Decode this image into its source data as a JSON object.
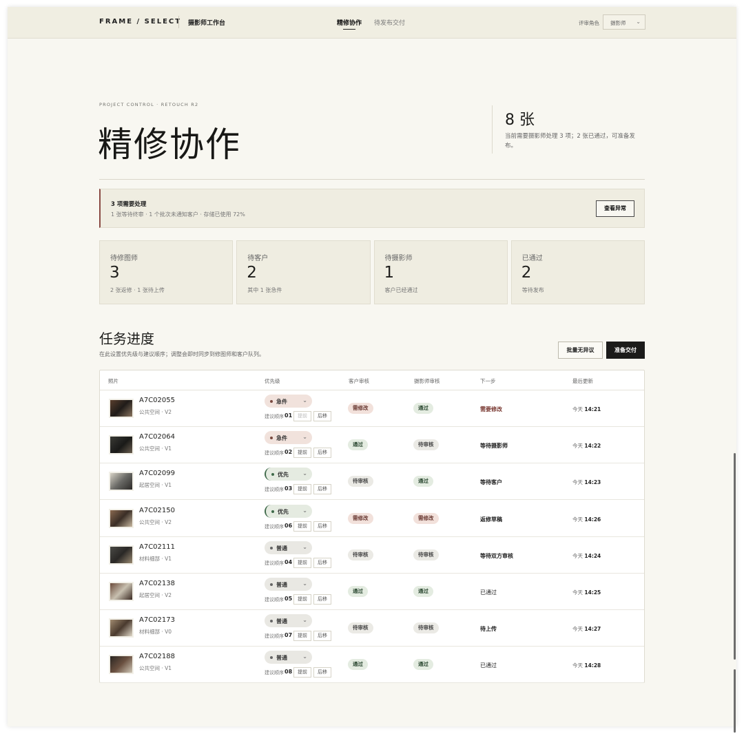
{
  "header": {
    "brand": "FRAME / SELECT",
    "subtitle": "摄影师工作台",
    "nav": [
      "精修协作",
      "待发布交付"
    ],
    "role_label": "评审角色",
    "role_value": "摄影师"
  },
  "hero": {
    "eyebrow": "PROJECT CONTROL · RETOUCH R2",
    "title": "精修协作",
    "count": "8 张",
    "count_note": "当前需要摄影师处理 3 项；2 张已通过，可准备发布。"
  },
  "alert": {
    "title": "3 项需要处理",
    "desc": "1 张等待终审 · 1 个批次未通知客户 · 存储已使用 72%",
    "button": "查看异常",
    "accent": "#8a4a43"
  },
  "cards": [
    {
      "label": "待修图师",
      "num": "3",
      "note": "2 张返修 · 1 张待上传"
    },
    {
      "label": "待客户",
      "num": "2",
      "note": "其中 1 张急件"
    },
    {
      "label": "待摄影师",
      "num": "1",
      "note": "客户已经通过"
    },
    {
      "label": "已通过",
      "num": "2",
      "note": "等待发布"
    }
  ],
  "section": {
    "title": "任务进度",
    "desc": "在此设置优先级与建议顺序；调整会即时同步到修图师和客户队列。",
    "btn_secondary": "批量无异议",
    "btn_primary": "准备交付"
  },
  "table": {
    "headers": [
      "照片",
      "优先级",
      "客户审核",
      "摄影师审核",
      "下一步",
      "最后更新"
    ],
    "order_label": "建议顺序",
    "up_label": "提前",
    "down_label": "后移",
    "rows": [
      {
        "id": "A7C02055",
        "meta": "公共空间 · V2",
        "priority": "急件",
        "order": "01",
        "client": "需修改",
        "photographer": "通过",
        "next": "需要修改",
        "day": "今天",
        "time": "14:21"
      },
      {
        "id": "A7C02064",
        "meta": "公共空间 · V1",
        "priority": "急件",
        "order": "02",
        "client": "通过",
        "photographer": "待审核",
        "next": "等待摄影师",
        "day": "今天",
        "time": "14:22"
      },
      {
        "id": "A7C02099",
        "meta": "起居空间 · V1",
        "priority": "优先",
        "order": "03",
        "client": "待审核",
        "photographer": "通过",
        "next": "等待客户",
        "day": "今天",
        "time": "14:23"
      },
      {
        "id": "A7C02150",
        "meta": "公共空间 · V2",
        "priority": "优先",
        "order": "06",
        "client": "需修改",
        "photographer": "需修改",
        "next": "返修草稿",
        "day": "今天",
        "time": "14:26"
      },
      {
        "id": "A7C02111",
        "meta": "材料细部 · V1",
        "priority": "普通",
        "order": "04",
        "client": "待审核",
        "photographer": "待审核",
        "next": "等待双方审核",
        "day": "今天",
        "time": "14:24"
      },
      {
        "id": "A7C02138",
        "meta": "起居空间 · V2",
        "priority": "普通",
        "order": "05",
        "client": "通过",
        "photographer": "通过",
        "next": "已通过",
        "day": "今天",
        "time": "14:25"
      },
      {
        "id": "A7C02173",
        "meta": "材料细部 · V0",
        "priority": "普通",
        "order": "07",
        "client": "待审核",
        "photographer": "待审核",
        "next": "待上传",
        "day": "今天",
        "time": "14:27"
      },
      {
        "id": "A7C02188",
        "meta": "公共空间 · V1",
        "priority": "普通",
        "order": "08",
        "client": "通过",
        "photographer": "通过",
        "next": "已通过",
        "day": "今天",
        "time": "14:28"
      }
    ]
  }
}
